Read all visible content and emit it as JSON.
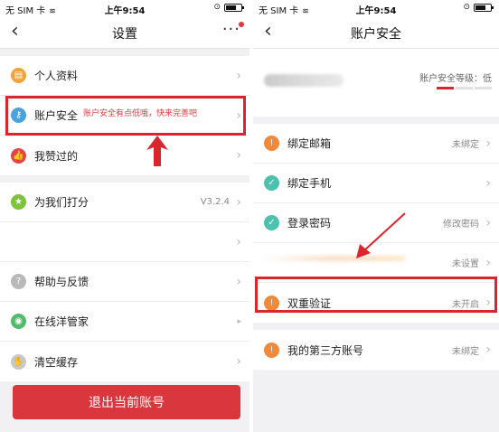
{
  "status_bar": {
    "carrier": "无 SIM 卡",
    "time": "上午9:54"
  },
  "left": {
    "title": "设置",
    "groups": [
      [
        {
          "label": "个人资料",
          "icon": "id-card-icon",
          "color": "#f0a23b"
        },
        {
          "label": "账户安全",
          "icon": "key-icon",
          "color": "#4aa3e0"
        },
        {
          "label": "我赞过的",
          "icon": "thumbs-up-icon",
          "color": "#e0474c"
        }
      ],
      [
        {
          "label": "为我们打分",
          "icon": "star-icon",
          "color": "#7bc43b",
          "value": "V3.2.4"
        },
        {
          "label": "",
          "icon": "",
          "color": ""
        },
        {
          "label": "帮助与反馈",
          "icon": "question-icon",
          "color": "#b9b9b9"
        },
        {
          "label": "在线洋管家",
          "icon": "chat-icon",
          "color": "#52bb6a"
        },
        {
          "label": "清空缓存",
          "icon": "broom-icon",
          "color": "#c8c8c8"
        }
      ]
    ],
    "hint": "账户安全有点低哦，快来完善吧",
    "logout_label": "退出当前账号"
  },
  "right": {
    "title": "账户安全",
    "level_label": "账户安全等级：低",
    "level": {
      "filled": 1,
      "total": 3
    },
    "items": [
      {
        "label": "绑定邮箱",
        "status": "未绑定",
        "icon": "warning-icon",
        "color": "#f08a3a"
      },
      {
        "label": "绑定手机",
        "status": "",
        "icon": "check-icon",
        "color": "#4cc1b0"
      },
      {
        "label": "登录密码",
        "status": "修改密码",
        "icon": "check-icon",
        "color": "#4cc1b0"
      },
      {
        "label": "",
        "status": "未设置",
        "icon": "",
        "color": ""
      },
      {
        "label": "双重验证",
        "status": "未开启",
        "icon": "warning-icon",
        "color": "#f08a3a"
      },
      {
        "label": "我的第三方账号",
        "status": "未绑定",
        "icon": "warning-icon",
        "color": "#f08a3a"
      }
    ]
  },
  "accent_color": "#d9252b"
}
